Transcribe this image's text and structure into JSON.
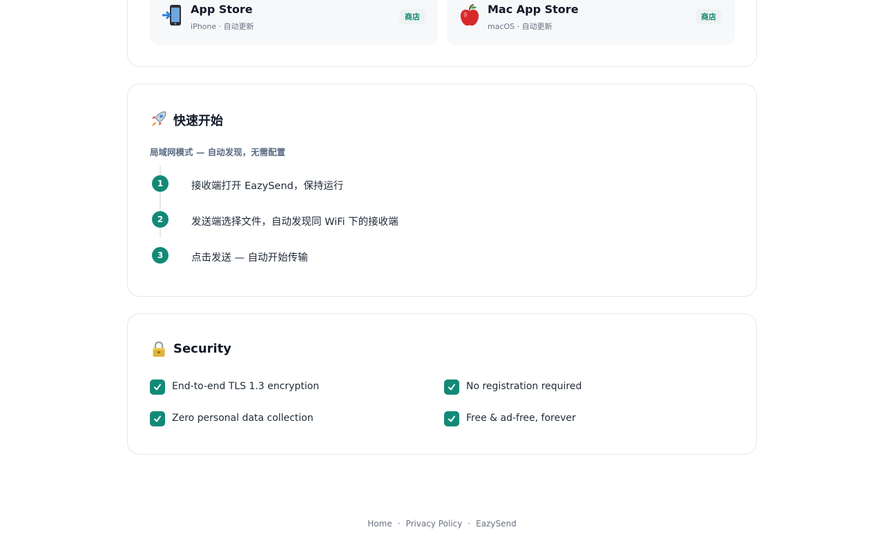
{
  "stores": [
    {
      "name": "App Store",
      "meta": "iPhone · 自动更新",
      "badge": "商店",
      "icon": "mobile-download-icon"
    },
    {
      "name": "Mac App Store",
      "meta": "macOS · 自动更新",
      "badge": "商店",
      "icon": "apple-icon"
    }
  ],
  "quick_start": {
    "icon": "rocket-icon",
    "title": "快速开始",
    "subtitle": "局域网模式 — 自动发现，无需配置",
    "steps": [
      {
        "num": "1",
        "text": "接收端打开 EazySend，保持运行"
      },
      {
        "num": "2",
        "text": "发送端选择文件，自动发现同 WiFi 下的接收端"
      },
      {
        "num": "3",
        "text": "点击发送 — 自动开始传输"
      }
    ]
  },
  "security": {
    "icon": "lock-icon",
    "title": "Security",
    "features": [
      "End-to-end TLS 1.3 encryption",
      "No registration required",
      "Zero personal data collection",
      "Free & ad-free, forever"
    ]
  },
  "footer": {
    "links": [
      "Home",
      "Privacy Policy",
      "EazySend"
    ],
    "separator": "·"
  },
  "colors": {
    "accent": "#128a77",
    "card_border": "#e4e7ec",
    "tile_bg": "#f7f8fa",
    "muted_text": "#6b7280"
  }
}
